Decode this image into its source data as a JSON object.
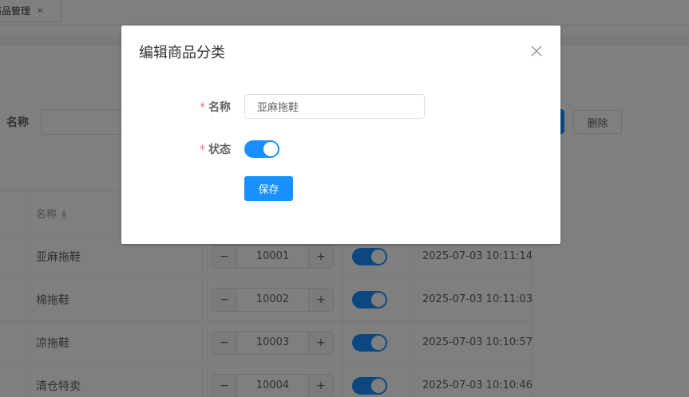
{
  "tabbar": {
    "active_tab": "商品管理",
    "close_glyph": "×"
  },
  "filter": {
    "name_label": "名称",
    "delete_label": "删除"
  },
  "table": {
    "name_header": "名称",
    "rows": [
      {
        "name": "亚麻拖鞋",
        "sort": "10001",
        "created": "2025-07-03 10:11:14"
      },
      {
        "name": "棉拖鞋",
        "sort": "10002",
        "created": "2025-07-03 10:11:03"
      },
      {
        "name": "凉拖鞋",
        "sort": "10003",
        "created": "2025-07-03 10:10:57"
      },
      {
        "name": "清仓特卖",
        "sort": "10004",
        "created": "2025-07-03 10:10:46"
      }
    ]
  },
  "stepper": {
    "minus": "−",
    "plus": "+"
  },
  "dialog": {
    "title": "编辑商品分类",
    "name_label": "名称",
    "name_value": "亚麻拖鞋",
    "status_label": "状态",
    "status_on": true,
    "save_label": "保存",
    "required_mark": "*"
  },
  "colors": {
    "primary": "#1890ff",
    "required": "#f56c6c",
    "mask": "rgba(0,0,0,0.5)"
  },
  "icons": {
    "close": "close-icon",
    "sort": "sort-caret-icon"
  }
}
